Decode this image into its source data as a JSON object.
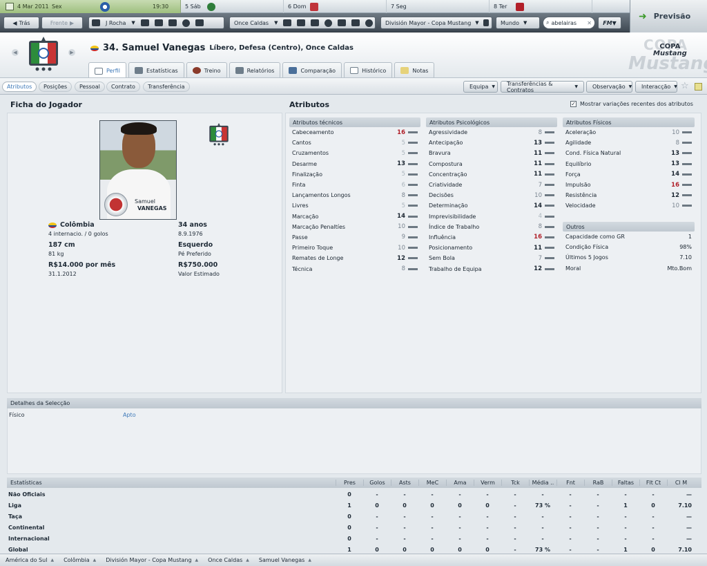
{
  "calendar": {
    "today_date": "4 Mar 2011",
    "today_day": "Sex",
    "time": "19:30",
    "days": [
      {
        "label": "5 Sáb",
        "crest": "#2e7d3a"
      },
      {
        "label": "6 Dom",
        "crest": "#c0343b"
      },
      {
        "label": "7 Seg",
        "crest": ""
      },
      {
        "label": "8 Ter",
        "crest": "#b2202a"
      }
    ]
  },
  "nav": {
    "back": "Trás",
    "forward": "Frente",
    "manager": "J Rocha",
    "club": "Once Caldas",
    "competition": "División Mayor - Copa Mustang",
    "world": "Mundo",
    "search_value": "abelairas",
    "fm": "FM",
    "continue": "Previsão"
  },
  "header": {
    "number_name": "34. Samuel Vanegas",
    "position": "Líbero, Defesa (Centro), Once Caldas",
    "copa_text1": "COPA",
    "copa_text2": "Mustang",
    "copa_logo1": "COPA",
    "copa_logo2": "Mustang",
    "tabs": [
      "Perfil",
      "Estatísticas",
      "Treino",
      "Relatórios",
      "Comparação",
      "Histórico",
      "Notas"
    ]
  },
  "subnav": {
    "pills": [
      "Atributos",
      "Posições",
      "Pessoal",
      "Contrato",
      "Transferência"
    ],
    "buttons": [
      "Equipa",
      "Transferências & Contratos",
      "Observação",
      "Interacção"
    ]
  },
  "profile": {
    "title": "Ficha do Jogador",
    "photo_first": "Samuel",
    "photo_last": "VANEGAS",
    "nation": "Colômbia",
    "caps": "4 internacio. / 0 golos",
    "height": "187 cm",
    "weight": "81 kg",
    "wage": "R$14.000 por mês",
    "contract": "31.1.2012",
    "age": "34 anos",
    "dob": "8.9.1976",
    "foot": "Esquerdo",
    "foot_label": "Pé Preferido",
    "value": "R$750.000",
    "value_label": "Valor Estimado"
  },
  "attributes": {
    "title": "Atributos",
    "show_changes": "Mostrar variações recentes dos atributos",
    "technical": {
      "head": "Atributos técnicos",
      "rows": [
        {
          "n": "Cabeceamento",
          "v": "16"
        },
        {
          "n": "Cantos",
          "v": "5"
        },
        {
          "n": "Cruzamentos",
          "v": "5"
        },
        {
          "n": "Desarme",
          "v": "13"
        },
        {
          "n": "Finalização",
          "v": "5"
        },
        {
          "n": "Finta",
          "v": "6"
        },
        {
          "n": "Lançamentos Longos",
          "v": "8"
        },
        {
          "n": "Livres",
          "v": "5"
        },
        {
          "n": "Marcação",
          "v": "14"
        },
        {
          "n": "Marcação Penaltíes",
          "v": "10"
        },
        {
          "n": "Passe",
          "v": "9"
        },
        {
          "n": "Primeiro Toque",
          "v": "10"
        },
        {
          "n": "Remates de Longe",
          "v": "12"
        },
        {
          "n": "Técnica",
          "v": "8"
        }
      ]
    },
    "mental": {
      "head": "Atributos Psicológicos",
      "rows": [
        {
          "n": "Agressividade",
          "v": "8"
        },
        {
          "n": "Antecipação",
          "v": "13"
        },
        {
          "n": "Bravura",
          "v": "11"
        },
        {
          "n": "Compostura",
          "v": "11"
        },
        {
          "n": "Concentração",
          "v": "11"
        },
        {
          "n": "Criatividade",
          "v": "7"
        },
        {
          "n": "Decisões",
          "v": "10"
        },
        {
          "n": "Determinação",
          "v": "14"
        },
        {
          "n": "Imprevisibilidade",
          "v": "4"
        },
        {
          "n": "Índice de Trabalho",
          "v": "8"
        },
        {
          "n": "Influência",
          "v": "16"
        },
        {
          "n": "Posicionamento",
          "v": "11"
        },
        {
          "n": "Sem Bola",
          "v": "7"
        },
        {
          "n": "Trabalho de Equipa",
          "v": "12"
        }
      ]
    },
    "physical": {
      "head": "Atributos Físicos",
      "rows": [
        {
          "n": "Aceleração",
          "v": "10"
        },
        {
          "n": "Agilidade",
          "v": "8"
        },
        {
          "n": "Cond. Física Natural",
          "v": "13"
        },
        {
          "n": "Equilíbrio",
          "v": "13"
        },
        {
          "n": "Força",
          "v": "14"
        },
        {
          "n": "Impulsão",
          "v": "16"
        },
        {
          "n": "Resistência",
          "v": "12"
        },
        {
          "n": "Velocidade",
          "v": "10"
        }
      ]
    },
    "other": {
      "head": "Outros",
      "rows": [
        {
          "n": "Capacidade como GR",
          "v": "1"
        },
        {
          "n": "Condição Física",
          "v": "98%"
        },
        {
          "n": "Últimos 5 Jogos",
          "v": "7.10"
        },
        {
          "n": "Moral",
          "v": "Mto.Bom"
        }
      ]
    }
  },
  "selection": {
    "head": "Detalhes da Selecção",
    "label": "Físico",
    "value": "Apto"
  },
  "stats": {
    "head": "Estatísticas",
    "columns": [
      "Pres",
      "Golos",
      "Asts",
      "MeC",
      "Ama",
      "Verm",
      "Tck",
      "Média ..",
      "Fnt",
      "RaB",
      "Faltas",
      "Flt Ct",
      "Cl M"
    ],
    "rows": [
      {
        "name": "Não Oficiais",
        "cells": [
          "0",
          "-",
          "-",
          "-",
          "-",
          "-",
          "-",
          "-",
          "-",
          "-",
          "-",
          "-",
          "—"
        ]
      },
      {
        "name": "Liga",
        "cells": [
          "1",
          "0",
          "0",
          "0",
          "0",
          "0",
          "-",
          "73 %",
          "-",
          "-",
          "1",
          "0",
          "7.10"
        ]
      },
      {
        "name": "Taça",
        "cells": [
          "0",
          "-",
          "-",
          "-",
          "-",
          "-",
          "-",
          "-",
          "-",
          "-",
          "-",
          "-",
          "—"
        ]
      },
      {
        "name": "Continental",
        "cells": [
          "0",
          "-",
          "-",
          "-",
          "-",
          "-",
          "-",
          "-",
          "-",
          "-",
          "-",
          "-",
          "—"
        ]
      },
      {
        "name": "Internacional",
        "cells": [
          "0",
          "-",
          "-",
          "-",
          "-",
          "-",
          "-",
          "-",
          "-",
          "-",
          "-",
          "-",
          "—"
        ]
      },
      {
        "name": "Global",
        "cells": [
          "1",
          "0",
          "0",
          "0",
          "0",
          "0",
          "-",
          "73 %",
          "-",
          "-",
          "1",
          "0",
          "7.10"
        ]
      }
    ]
  },
  "footer": {
    "crumbs": [
      "América do Sul",
      "Colômbia",
      "División Mayor - Copa Mustang",
      "Once Caldas",
      "Samuel Vanegas"
    ]
  }
}
